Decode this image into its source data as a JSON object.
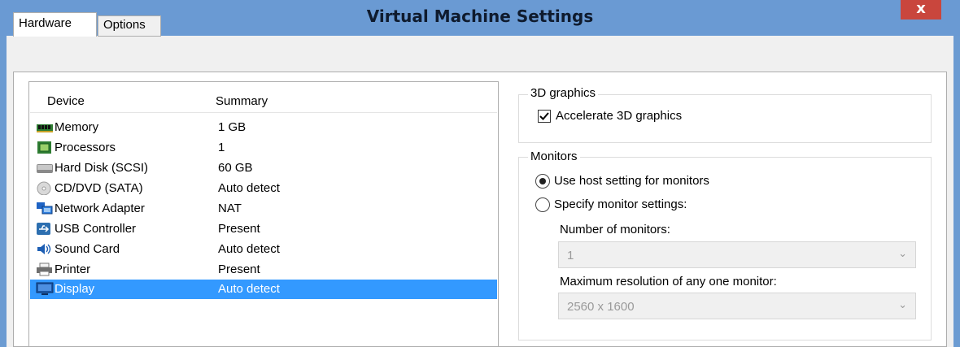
{
  "window": {
    "title": "Virtual Machine Settings",
    "close_glyph": "x"
  },
  "tabs": [
    {
      "label": "Hardware",
      "selected": true
    },
    {
      "label": "Options",
      "selected": false
    }
  ],
  "device_list": {
    "columns": {
      "device": "Device",
      "summary": "Summary"
    },
    "devices": [
      {
        "name": "Memory",
        "summary": "1 GB",
        "icon": "memory-icon"
      },
      {
        "name": "Processors",
        "summary": "1",
        "icon": "processor-icon"
      },
      {
        "name": "Hard Disk (SCSI)",
        "summary": "60 GB",
        "icon": "hard-disk-icon"
      },
      {
        "name": "CD/DVD (SATA)",
        "summary": "Auto detect",
        "icon": "cd-dvd-icon"
      },
      {
        "name": "Network Adapter",
        "summary": "NAT",
        "icon": "network-adapter-icon"
      },
      {
        "name": "USB Controller",
        "summary": "Present",
        "icon": "usb-icon"
      },
      {
        "name": "Sound Card",
        "summary": "Auto detect",
        "icon": "sound-card-icon"
      },
      {
        "name": "Printer",
        "summary": "Present",
        "icon": "printer-icon"
      },
      {
        "name": "Display",
        "summary": "Auto detect",
        "icon": "display-icon",
        "selected": true
      }
    ]
  },
  "graphics_3d": {
    "group_label": "3D graphics",
    "accelerate_label": "Accelerate 3D graphics",
    "accelerate_checked": true
  },
  "monitors": {
    "group_label": "Monitors",
    "use_host_label": "Use host setting for monitors",
    "specify_label": "Specify monitor settings:",
    "selected_option": "use_host",
    "number_label": "Number of monitors:",
    "number_value": "1",
    "max_res_label": "Maximum resolution of any one monitor:",
    "max_res_value": "2560 x 1600"
  },
  "colors": {
    "title_bar": "#6a9ad3",
    "selection": "#3399ff",
    "close_button": "#c9463d"
  }
}
